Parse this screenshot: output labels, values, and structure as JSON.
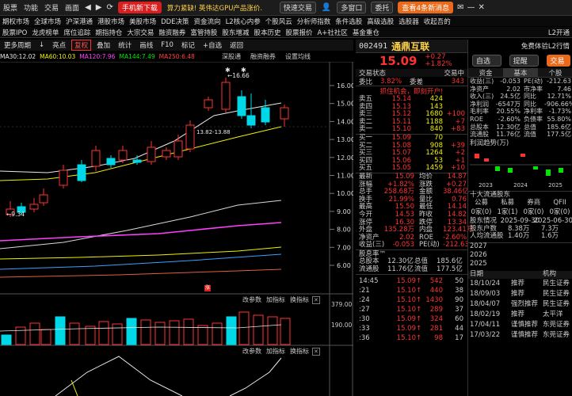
{
  "topbar": {
    "items": [
      "股票",
      "功能",
      "交易",
      "画面"
    ],
    "phone_btn": "手机新下载",
    "news": "算力紧缺! 英伟达GPU产品涨价...",
    "trade_btn": "快速交易",
    "right_items": [
      "多窗口",
      "委托",
      "查看4条新消息"
    ]
  },
  "menu2": [
    "期权市场",
    "全球市场",
    "沪深港通",
    "港股市场",
    "美股市场",
    "DDE决策",
    "资金流向",
    "L2核心内参",
    "个股风云",
    "分析师指数",
    "条件选股",
    "高级选股",
    "选股器",
    "收起吾的"
  ],
  "menu3": [
    "股票IPO",
    "龙虎榜单",
    "席位追踪",
    "期指持仓",
    "大宗交易",
    "融资融券",
    "富管持股",
    "股东增减",
    "股本历史",
    "股票报价",
    "A+社社区",
    "基金重仓",
    "L2开通"
  ],
  "chart_toolbar": {
    "items": [
      "更多周期",
      "↓",
      "亮点",
      "复权",
      "叠加",
      "统计",
      "画线",
      "F10",
      "标记",
      "+自选",
      "返回"
    ],
    "active": "复权"
  },
  "chart_tabs": [
    "深股通",
    "融资融券",
    "设置均线"
  ],
  "ma_line": [
    {
      "label": "MA30:12.02",
      "color": "#e8e8e8"
    },
    {
      "label": "MA60:10.03",
      "color": "#f0f000"
    },
    {
      "label": "MA120:7.96",
      "color": "#ff40ff"
    },
    {
      "label": "MA144:7.49",
      "color": "#00e600"
    },
    {
      "label": "MA250:6.48",
      "color": "#3aa0ff"
    }
  ],
  "price_axis": [
    "16.00",
    "15.00",
    "14.00",
    "13.00",
    "12.00",
    "11.00",
    "10.00",
    "9.00",
    "8.00",
    "7.00",
    "6.00"
  ],
  "annotations": {
    "high": "16.66",
    "low": "9.34",
    "mid_range": "13.82-13.88"
  },
  "vol_panel": {
    "tabs": [
      "改参数",
      "加指标",
      "换指标"
    ],
    "axis": [
      "379.00",
      "190.00"
    ]
  },
  "macd_panel": {
    "tabs": [
      "改参数",
      "加指标",
      "换指标"
    ]
  },
  "stock": {
    "code": "002491",
    "name": "通鼎互联",
    "price": "15.09",
    "change": "+0.27",
    "pct": "+1.82%",
    "btn_select": "自选",
    "btn_alert": "提醒",
    "btn_trade": "交易"
  },
  "panel_labels": {
    "status": "交易状态",
    "trading": "交易中",
    "webi": "委比",
    "webi_val": "3.82%",
    "wecha": "委差",
    "wecha_val": "343",
    "promo": "抓住机会，即刻开户!"
  },
  "sell_book": [
    {
      "l": "卖五",
      "p": "15.14",
      "v": "424",
      "d": ""
    },
    {
      "l": "卖四",
      "p": "15.13",
      "v": "143",
      "d": ""
    },
    {
      "l": "卖三",
      "p": "15.12",
      "v": "1680",
      "d": "+100"
    },
    {
      "l": "卖二",
      "p": "15.11",
      "v": "1188",
      "d": "+7"
    },
    {
      "l": "卖一",
      "p": "15.10",
      "v": "840",
      "d": "+83"
    }
  ],
  "buy_book": [
    {
      "l": "买一",
      "p": "15.09",
      "v": "70",
      "d": ""
    },
    {
      "l": "买二",
      "p": "15.08",
      "v": "908",
      "d": "+39"
    },
    {
      "l": "买三",
      "p": "15.07",
      "v": "1264",
      "d": "+2"
    },
    {
      "l": "买四",
      "p": "15.06",
      "v": "53",
      "d": "+1"
    },
    {
      "l": "买五",
      "p": "15.05",
      "v": "1459",
      "d": "+10"
    }
  ],
  "stats": [
    [
      "最新",
      "15.09",
      "均价",
      "14.87"
    ],
    [
      "涨幅",
      "+1.82%",
      "涨跌",
      "+0.27"
    ],
    [
      "总手",
      "258.68万",
      "金额",
      "38.46亿"
    ],
    [
      "换手",
      "21.99%",
      "量比",
      "0.76"
    ],
    [
      "最高",
      "15.50",
      "最低",
      "14.14"
    ],
    [
      "今开",
      "14.53",
      "昨收",
      "14.82"
    ],
    [
      "涨停",
      "16.30",
      "跌停",
      "13.34"
    ],
    [
      "外盘",
      "135.28万",
      "内盘",
      "123.41万"
    ],
    [
      "净资产",
      "2.02",
      "ROE",
      "-2.60%"
    ],
    [
      "收益(三)",
      "-0.053",
      "PE(动)",
      "-212.63"
    ]
  ],
  "equity": {
    "title": "股息率™",
    "row1": [
      "总股本",
      "12.30亿",
      "总值",
      "185.6亿"
    ],
    "row2": [
      "流通股",
      "11.76亿",
      "流值",
      "177.5亿"
    ]
  },
  "ticks": [
    {
      "t": "14:45",
      "p": "15.09",
      "v": "542",
      "n": "50"
    },
    {
      "t": ":21",
      "p": "15.10",
      "v": "440",
      "n": "38"
    },
    {
      "t": ":24",
      "p": "15.10",
      "v": "1430",
      "n": "90"
    },
    {
      "t": ":27",
      "p": "15.10",
      "v": "289",
      "n": "37"
    },
    {
      "t": ":30",
      "p": "15.09",
      "v": "324",
      "n": "60"
    },
    {
      "t": ":33",
      "p": "15.09",
      "v": "281",
      "n": "44"
    },
    {
      "t": ":36",
      "p": "15.10",
      "v": "98",
      "n": "17"
    }
  ],
  "f10": {
    "right_tab": "免费体验L2行情",
    "tabs": [
      "资金",
      "基本",
      "个股"
    ],
    "rows": [
      [
        "收益(三)",
        "-0.053",
        "PE(动)",
        "-212.63"
      ],
      [
        "净资产",
        "2.02",
        "市净率",
        "7.46"
      ],
      [
        "收入(三)",
        "24.5亿",
        "同比",
        "12.71%"
      ],
      [
        "净利润",
        "-6547万",
        "同比",
        "-906.66%"
      ],
      [
        "毛利率",
        "20.55%",
        "净利率",
        "-1.73%"
      ],
      [
        "ROE",
        "-2.60%",
        "负债率",
        "55.80%"
      ],
      [
        "总股本",
        "12.30亿",
        "总值",
        "185.6亿"
      ],
      [
        "流通股",
        "11.76亿",
        "流值",
        "177.5亿"
      ]
    ],
    "profit_title": "利润趋势(万)",
    "profit_years": [
      "2023",
      "2024",
      "2025"
    ],
    "holders_title": "十大流通股东",
    "holder_tabs": [
      "公募",
      "私募",
      "券商",
      "QFII"
    ],
    "holder_counts": [
      "0家(0)",
      "1家(1)",
      "0家(0)",
      "0家(0)"
    ],
    "holder_info": [
      [
        "股东情况",
        "2025-09-30",
        "2025-06-30"
      ],
      [
        "股东户数",
        "8.38万",
        "7.3万"
      ],
      [
        "人均流通股",
        "1.40万",
        "1.6万"
      ]
    ],
    "year_list": [
      "2027",
      "2026",
      "2025"
    ],
    "rating_header": [
      "日期",
      "",
      "机构"
    ],
    "ratings": [
      [
        "18/10/24",
        "推荐",
        "民生证券"
      ],
      [
        "18/09/03",
        "推荐",
        "民生证券"
      ],
      [
        "18/04/07",
        "强烈推荐",
        "民生证券"
      ],
      [
        "18/02/19",
        "推荐",
        "太平洋"
      ],
      [
        "17/04/11",
        "谨慎推荐",
        "东莞证券"
      ],
      [
        "17/03/22",
        "谨慎推荐",
        "东莞证券"
      ]
    ]
  },
  "colors": {
    "up": "#ff3232",
    "down": "#00d8e8",
    "bg": "#000000",
    "accent": "#d81e1e"
  }
}
